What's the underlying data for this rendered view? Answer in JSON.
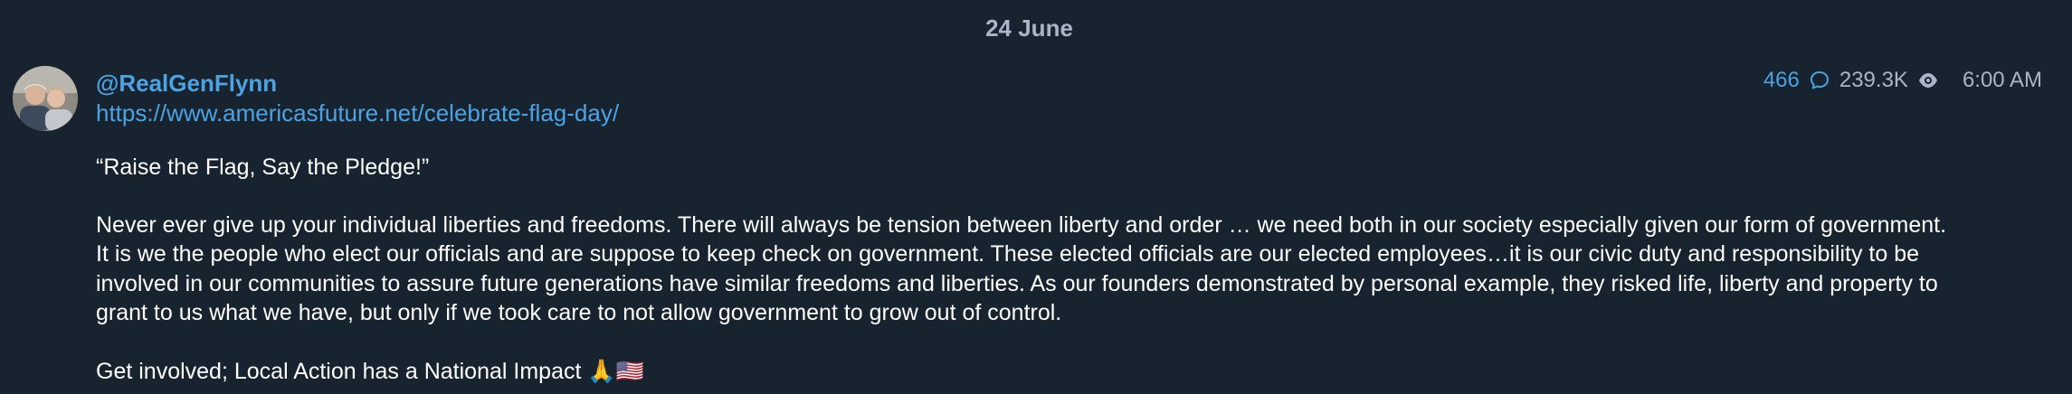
{
  "date_separator": "24 June",
  "post": {
    "author": "@RealGenFlynn",
    "link": "https://www.americasfuture.net/celebrate-flag-day/",
    "headline": "“Raise the Flag, Say the Pledge!”",
    "body": "Never ever give up your individual liberties and freedoms. There will always be tension between liberty and order … we need both in our society especially given our form of government. It is we the people who elect our officials and are suppose to keep check on government. These elected officials are our elected employees…it is our civic duty and responsibility to be involved in our communities to assure future generations have similar freedoms and liberties. As our founders demonstrated by personal example, they risked life, liberty and property to grant to us what we have, but only if we took care to not allow government to grow out of control.",
    "closing": "Get involved; Local Action has a National Impact",
    "closing_emoji": "🙏🇺🇸",
    "replies": "466",
    "views": "239.3K",
    "time": "6:00 AM"
  },
  "icons": {
    "replies": "comment-bubble-icon",
    "views": "eye-icon"
  },
  "colors": {
    "background": "#182330",
    "accent": "#4ba3e3",
    "muted": "#a9b6c6",
    "text": "#ffffff"
  }
}
